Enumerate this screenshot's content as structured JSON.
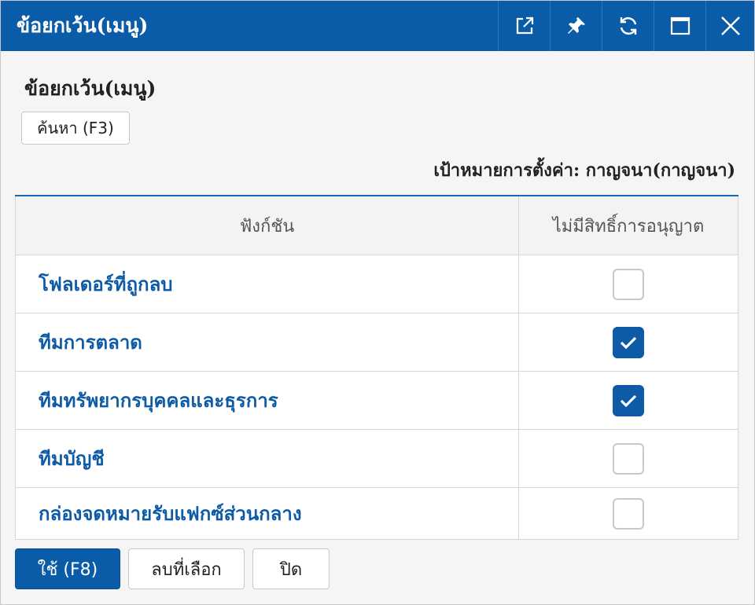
{
  "window": {
    "title": "ข้อยกเว้น(เมนู)",
    "icons": [
      "external-link-icon",
      "pin-icon",
      "refresh-icon",
      "maximize-icon",
      "close-icon"
    ]
  },
  "content": {
    "section_title": "ข้อยกเว้น(เมนู)",
    "search_button": "ค้นหา (F3)",
    "target_label": "เป้าหมายการตั้งค่า: กาญจนา(กาญจนา)"
  },
  "table": {
    "headers": [
      "ฟังก์ชัน",
      "ไม่มีสิทธิ์การอนุญาต"
    ],
    "rows": [
      {
        "name": "โฟลเดอร์ที่ถูกลบ",
        "checked": false
      },
      {
        "name": "ทีมการตลาด",
        "checked": true
      },
      {
        "name": "ทีมทรัพยากรบุคคลและธุรการ",
        "checked": true
      },
      {
        "name": "ทีมบัญชี",
        "checked": false
      },
      {
        "name": "กล่องจดหมายรับแฟกซ์ส่วนกลาง",
        "checked": false
      }
    ]
  },
  "footer": {
    "apply": "ใช้ (F8)",
    "clear_selection": "ลบที่เลือก",
    "close": "ปิด"
  },
  "colors": {
    "titlebar": "#0a5ca8",
    "accent": "#0d5aa7",
    "background": "#f5f5f5"
  }
}
